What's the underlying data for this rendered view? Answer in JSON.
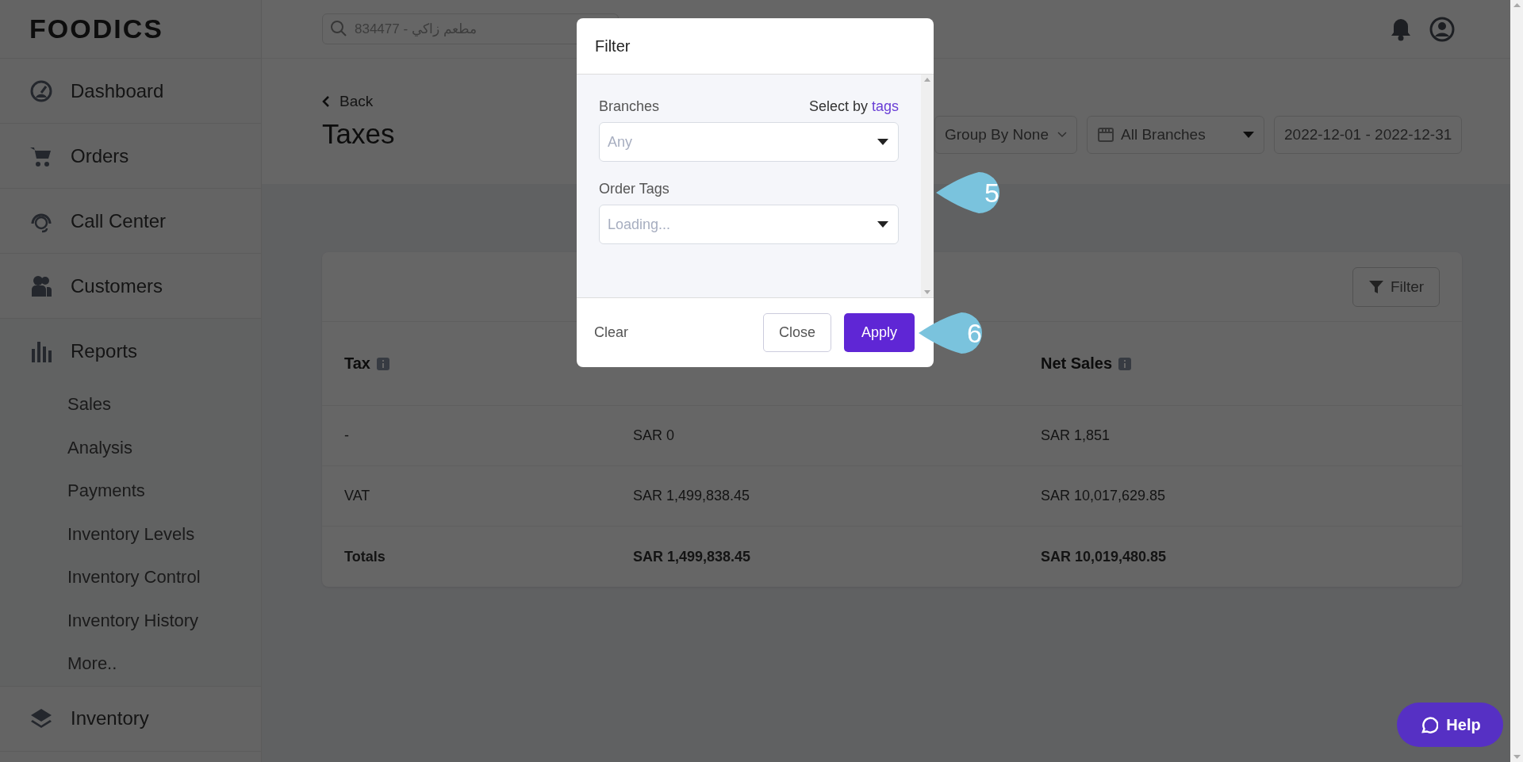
{
  "logo": "FOODICS",
  "search": {
    "placeholder": "834477 - مطعم زاكي"
  },
  "sidebar": {
    "items": [
      {
        "label": "Dashboard"
      },
      {
        "label": "Orders"
      },
      {
        "label": "Call Center"
      },
      {
        "label": "Customers"
      },
      {
        "label": "Reports",
        "expanded": true,
        "children": [
          {
            "label": "Sales"
          },
          {
            "label": "Analysis"
          },
          {
            "label": "Payments"
          },
          {
            "label": "Inventory Levels"
          },
          {
            "label": "Inventory Control"
          },
          {
            "label": "Inventory History"
          },
          {
            "label": "More.."
          }
        ]
      },
      {
        "label": "Inventory"
      }
    ]
  },
  "page": {
    "back": "Back",
    "title": "Taxes",
    "group_by": "Group By None",
    "branches": "All Branches",
    "date_range": "2022-12-01 - 2022-12-31"
  },
  "table": {
    "filter_button": "Filter",
    "columns": [
      "Tax",
      null,
      "Net Sales"
    ],
    "rows": [
      [
        "-",
        "SAR 0",
        "SAR 1,851"
      ],
      [
        "VAT",
        "SAR 1,499,838.45",
        "SAR 10,017,629.85"
      ]
    ],
    "totals": [
      "Totals",
      "SAR 1,499,838.45",
      "SAR 10,019,480.85"
    ]
  },
  "modal": {
    "title": "Filter",
    "fields": [
      {
        "label": "Branches",
        "link_prefix": "Select by",
        "link": "tags",
        "placeholder": "Any"
      },
      {
        "label": "Order Tags",
        "placeholder": "Loading..."
      }
    ],
    "clear": "Clear",
    "close": "Close",
    "apply": "Apply"
  },
  "callouts": [
    "5",
    "6"
  ],
  "help": "Help"
}
